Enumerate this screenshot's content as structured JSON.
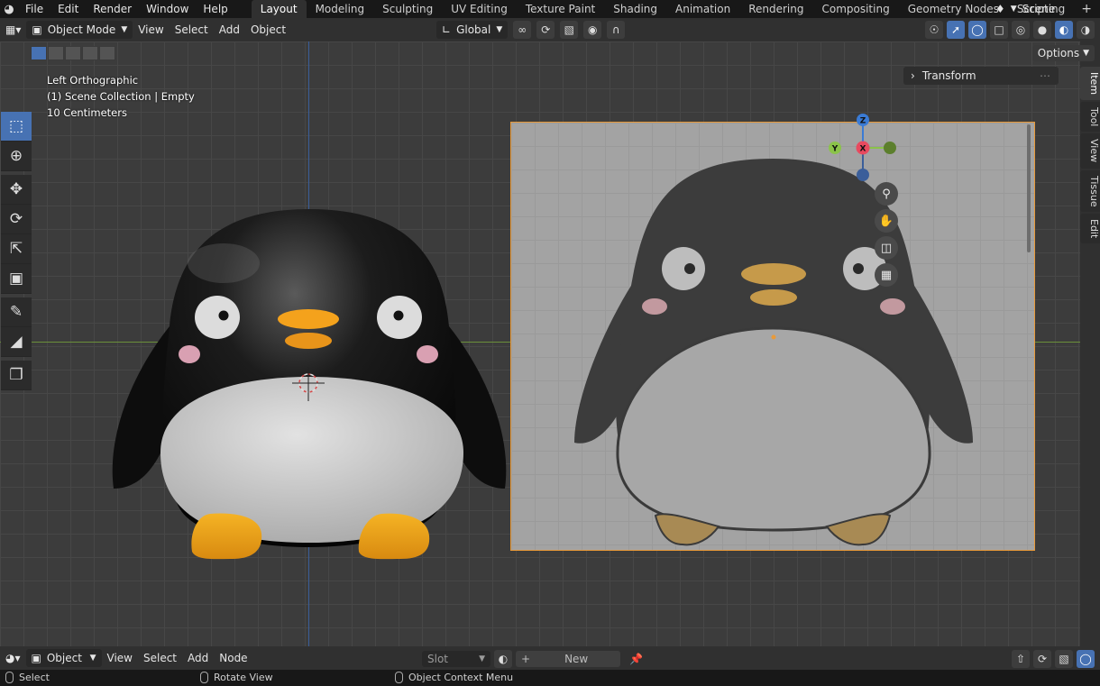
{
  "menu": [
    "File",
    "Edit",
    "Render",
    "Window",
    "Help"
  ],
  "workspaces": [
    "Layout",
    "Modeling",
    "Sculpting",
    "UV Editing",
    "Texture Paint",
    "Shading",
    "Animation",
    "Rendering",
    "Compositing",
    "Geometry Nodes",
    "Scripting"
  ],
  "workspace_add": "+",
  "scene_label": "Scene",
  "header": {
    "mode": "Object Mode",
    "view": "View",
    "select": "Select",
    "add": "Add",
    "object": "Object",
    "orientation": "Global",
    "options": "Options"
  },
  "viewport_info": {
    "view_name": "Left Orthographic",
    "collection": "(1) Scene Collection | Empty",
    "scale": "10 Centimeters"
  },
  "gizmo": {
    "z": "Z",
    "y": "Y",
    "x": "X"
  },
  "sidebar": {
    "panel_title": "Transform",
    "tabs": [
      "Item",
      "Tool",
      "View",
      "Tissue",
      "Edit"
    ]
  },
  "bottom": {
    "editor_mode": "Object",
    "view": "View",
    "select": "Select",
    "add": "Add",
    "node": "Node",
    "slot": "Slot",
    "new_plus": "+",
    "new": "New"
  },
  "status": {
    "select": "Select",
    "rotate": "Rotate View",
    "context": "Object Context Menu"
  },
  "colors": {
    "accent": "#4772b3",
    "x_axis": "#e84a5f",
    "y_axis": "#8bc34a",
    "z_axis": "#3a7bd5",
    "image_border": "#e89a3a"
  }
}
